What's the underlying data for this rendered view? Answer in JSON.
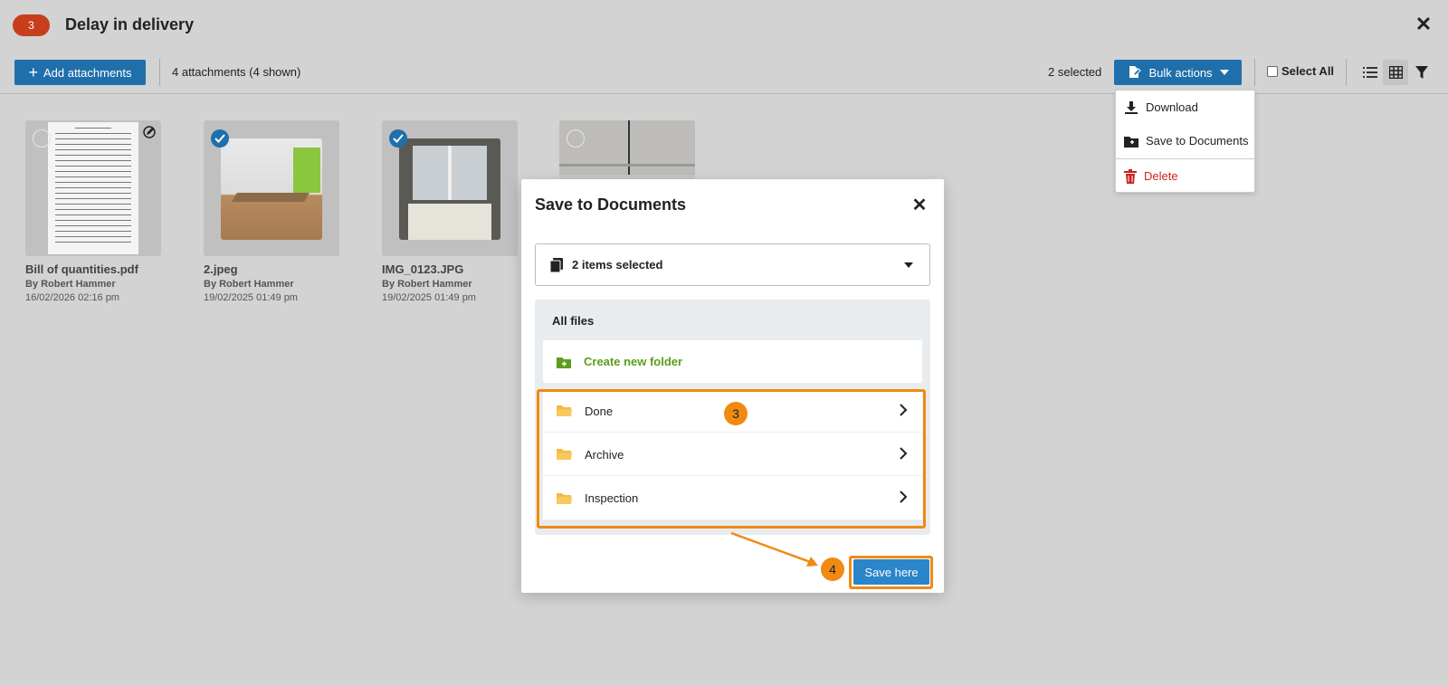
{
  "header": {
    "badge": "3",
    "title": "Delay in delivery"
  },
  "toolbar": {
    "add_label": "Add attachments",
    "attachment_count": "4 attachments (4 shown)",
    "selected_count": "2 selected",
    "bulk_label": "Bulk actions",
    "select_all_label": "Select All"
  },
  "attachments": [
    {
      "name": "Bill of quantities.pdf",
      "by": "By Robert Hammer",
      "date": "16/02/2026 02:16 pm",
      "selected": false
    },
    {
      "name": "2.jpeg",
      "by": "By Robert Hammer",
      "date": "19/02/2025 01:49 pm",
      "selected": true
    },
    {
      "name": "IMG_0123.JPG",
      "by": "By Robert Hammer",
      "date": "19/02/2025 01:49 pm",
      "selected": true
    },
    {
      "name": "",
      "by": "",
      "date": "",
      "selected": false
    }
  ],
  "bulk_menu": {
    "download": "Download",
    "save_to_documents": "Save to Documents",
    "delete": "Delete"
  },
  "modal": {
    "title": "Save to Documents",
    "selection": "2 items selected",
    "all_files": "All files",
    "create_folder": "Create new folder",
    "folders": [
      "Done",
      "Archive",
      "Inspection"
    ],
    "save_label": "Save here"
  },
  "annotations": {
    "step_folders": "3",
    "step_save": "4"
  },
  "colors": {
    "primary": "#1f6fab",
    "highlight": "#f08a12",
    "badge": "#c83e1c",
    "delete": "#c8231f",
    "folder": "#f5b93e",
    "green": "#5a9e1c"
  }
}
